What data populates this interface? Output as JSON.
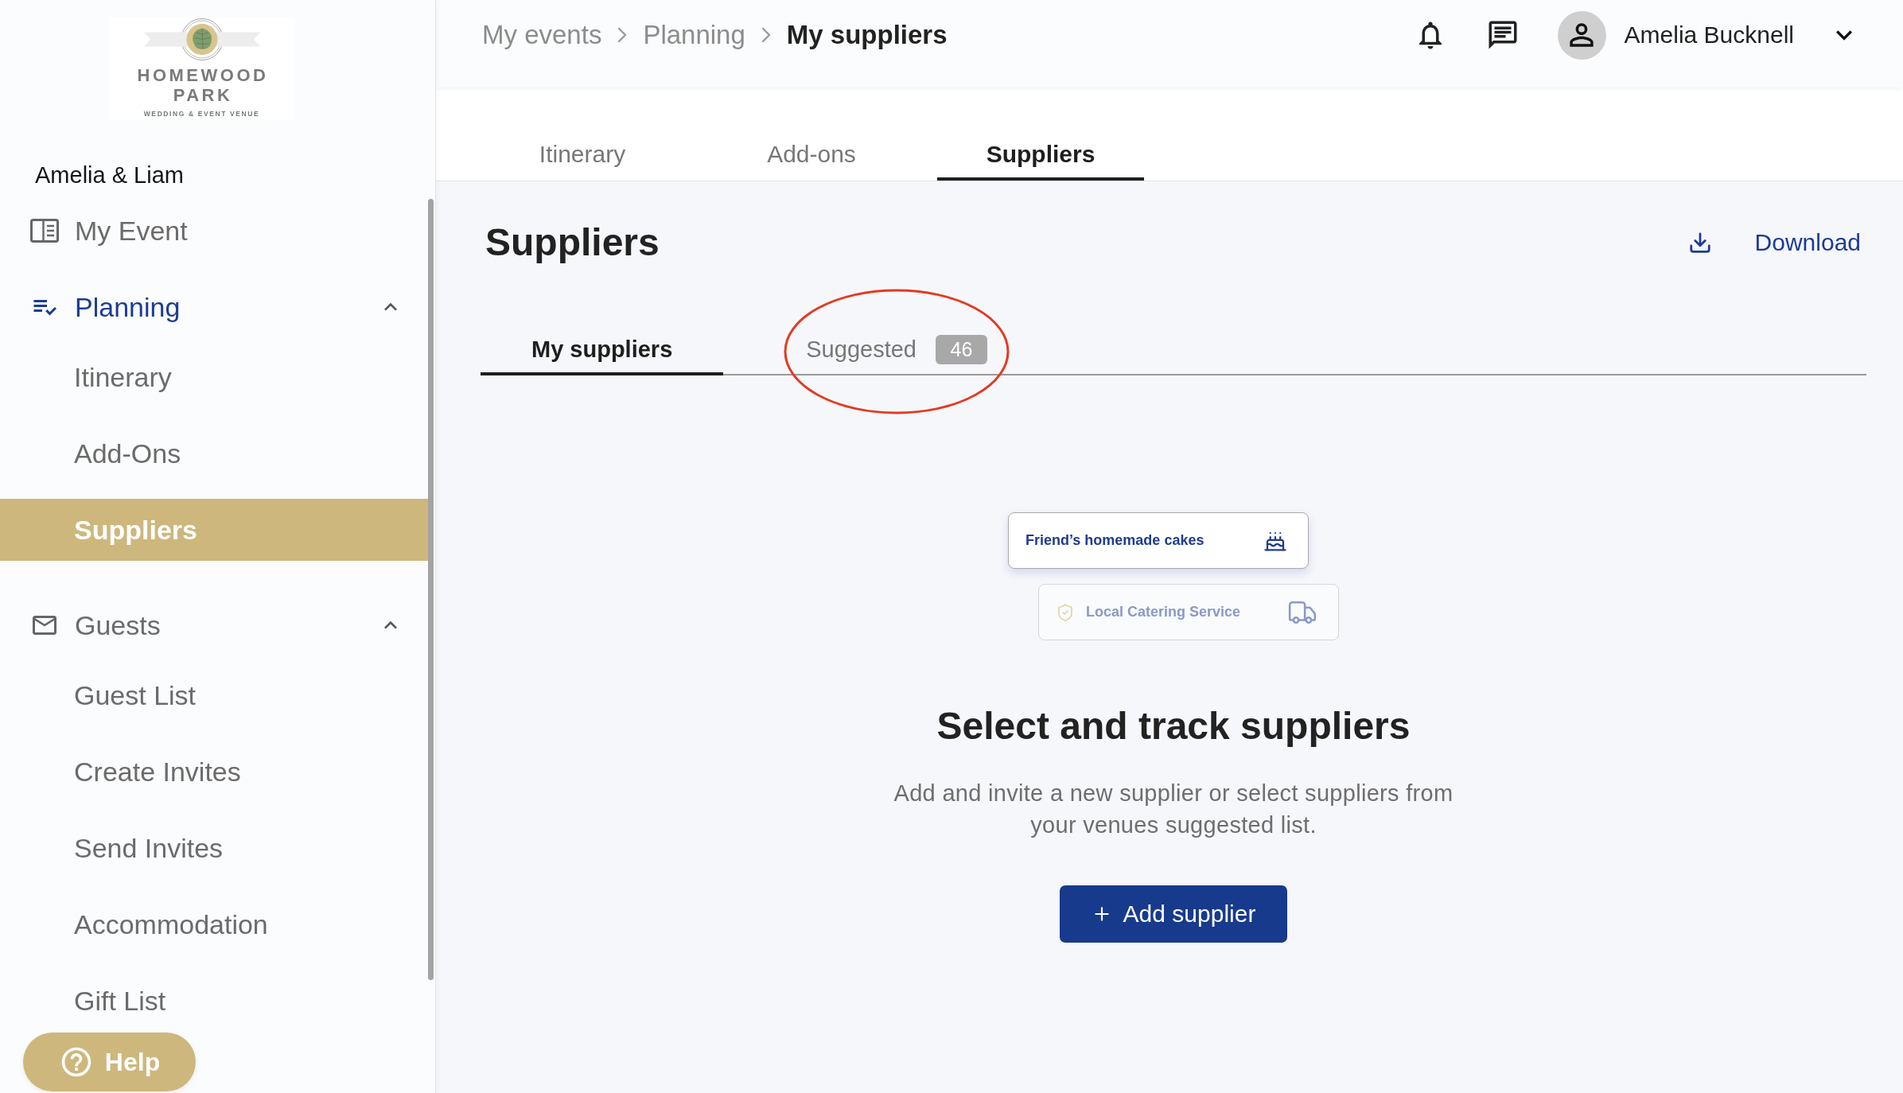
{
  "sidebar": {
    "logo": {
      "name": "HOMEWOOD PARK",
      "tagline": "WEDDING & EVENT VENUE"
    },
    "event_name": "Amelia & Liam",
    "nav": [
      {
        "label": "My Event",
        "selected": false
      },
      {
        "label": "Planning",
        "selected": true,
        "expanded": true,
        "children": [
          {
            "label": "Itinerary",
            "selected": false
          },
          {
            "label": "Add-Ons",
            "selected": false
          },
          {
            "label": "Suppliers",
            "selected": true
          }
        ]
      },
      {
        "label": "Guests",
        "selected": false,
        "expanded": true,
        "children": [
          {
            "label": "Guest List",
            "selected": false
          },
          {
            "label": "Create Invites",
            "selected": false
          },
          {
            "label": "Send Invites",
            "selected": false
          },
          {
            "label": "Accommodation",
            "selected": false
          },
          {
            "label": "Gift List",
            "selected": false
          }
        ]
      }
    ]
  },
  "help_button": {
    "label": "Help"
  },
  "header": {
    "breadcrumbs": [
      {
        "label": "My events",
        "current": false
      },
      {
        "label": "Planning",
        "current": false
      },
      {
        "label": "My suppliers",
        "current": true
      }
    ],
    "user": {
      "name": "Amelia Bucknell"
    }
  },
  "top_tabs": [
    {
      "label": "Itinerary",
      "selected": false
    },
    {
      "label": "Add-ons",
      "selected": false
    },
    {
      "label": "Suppliers",
      "selected": true
    }
  ],
  "page": {
    "title": "Suppliers",
    "download_label": "Download"
  },
  "sub_tabs": [
    {
      "label": "My suppliers",
      "selected": true
    },
    {
      "label": "Suggested",
      "selected": false,
      "badge": "46",
      "circled": true
    }
  ],
  "empty_state": {
    "cards": [
      {
        "kind": "cake",
        "label": "Friend’s homemade cakes",
        "faded": false,
        "verified": false
      },
      {
        "kind": "catering",
        "label": "Local Catering Service",
        "faded": true,
        "verified": true
      }
    ],
    "title": "Select and track suppliers",
    "description": "Add and invite a new supplier or select suppliers from your venues suggested list.",
    "button_label": "Add supplier"
  }
}
